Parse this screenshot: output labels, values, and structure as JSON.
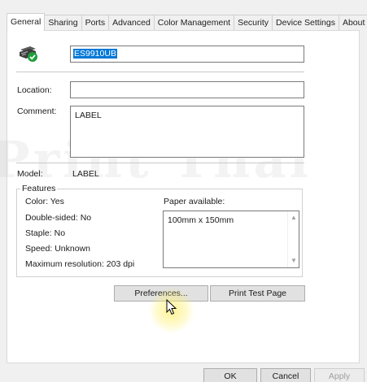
{
  "tabs": [
    {
      "label": "General",
      "active": true
    },
    {
      "label": "Sharing",
      "active": false
    },
    {
      "label": "Ports",
      "active": false
    },
    {
      "label": "Advanced",
      "active": false
    },
    {
      "label": "Color Management",
      "active": false
    },
    {
      "label": "Security",
      "active": false
    },
    {
      "label": "Device Settings",
      "active": false
    },
    {
      "label": "About",
      "active": false
    }
  ],
  "printer": {
    "icon": "printer-default-icon",
    "name": "ES9910UB"
  },
  "fields": {
    "location_label": "Location:",
    "location_value": "",
    "comment_label": "Comment:",
    "comment_value": "LABEL",
    "model_label": "Model:",
    "model_value": "LABEL"
  },
  "features": {
    "title": "Features",
    "color": "Color: Yes",
    "double_sided": "Double-sided: No",
    "staple": "Staple: No",
    "speed": "Speed: Unknown",
    "max_resolution": "Maximum resolution: 203 dpi",
    "paper_label": "Paper available:",
    "paper_items": [
      "100mm x 150mm"
    ]
  },
  "buttons": {
    "preferences": "Preferences...",
    "print_test_page": "Print Test Page",
    "ok": "OK",
    "cancel": "Cancel",
    "apply": "Apply"
  },
  "watermark": "Print Thai",
  "colors": {
    "selection": "#0078d7",
    "cursor_highlight": "#fff06e"
  }
}
